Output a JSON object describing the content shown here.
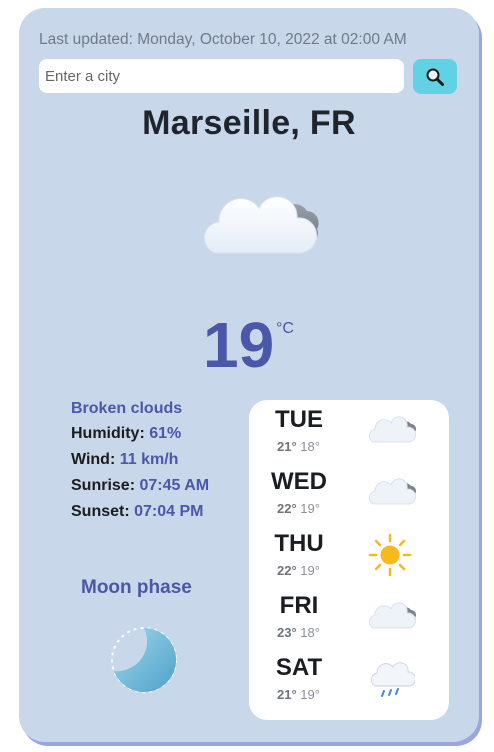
{
  "last_updated": "Last updated: Monday, October 10, 2022 at 02:00 AM",
  "search": {
    "placeholder": "Enter a city"
  },
  "icons": {
    "search": "magnifier-icon",
    "current": "broken-clouds-icon",
    "moon": "moon-phase-icon"
  },
  "colors": {
    "card": "#c8d8ea",
    "accent": "#4b57a8",
    "button": "#60d2e4"
  },
  "city": "Marseille, FR",
  "current": {
    "temp": "19",
    "unit": "°C",
    "description": "Broken clouds",
    "humidity_label": "Humidity:",
    "humidity": "61%",
    "wind_label": "Wind:",
    "wind": "11 km/h",
    "sunrise_label": "Sunrise:",
    "sunrise": "07:45 AM",
    "sunset_label": "Sunset:",
    "sunset": "07:04 PM"
  },
  "moon": {
    "label": "Moon phase"
  },
  "forecast": [
    {
      "day": "TUE",
      "max": "21°",
      "min": "18°",
      "icon": "broken-clouds-icon"
    },
    {
      "day": "WED",
      "max": "22°",
      "min": "19°",
      "icon": "broken-clouds-icon"
    },
    {
      "day": "THU",
      "max": "22°",
      "min": "19°",
      "icon": "sun-icon"
    },
    {
      "day": "FRI",
      "max": "23°",
      "min": "18°",
      "icon": "broken-clouds-icon"
    },
    {
      "day": "SAT",
      "max": "21°",
      "min": "19°",
      "icon": "rain-cloud-icon"
    }
  ]
}
